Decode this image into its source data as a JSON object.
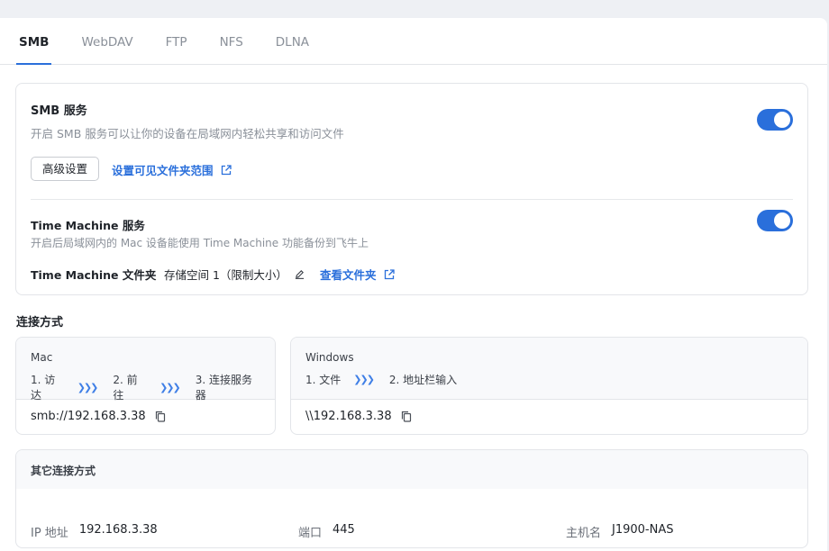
{
  "tabs": [
    {
      "label": "SMB",
      "active": true
    },
    {
      "label": "WebDAV"
    },
    {
      "label": "FTP"
    },
    {
      "label": "NFS"
    },
    {
      "label": "DLNA"
    }
  ],
  "smb": {
    "title": "SMB 服务",
    "description": "开启 SMB 服务可以让你的设备在局域网内轻松共享和访问文件",
    "enabled": true,
    "advanced_button": "高级设置",
    "visible_scope_link": "设置可见文件夹范围"
  },
  "time_machine": {
    "title": "Time Machine 服务",
    "description": "开启后局域网内的 Mac 设备能使用 Time Machine 功能备份到飞牛上",
    "enabled": true,
    "folder_label": "Time Machine 文件夹",
    "folder_value": "存储空间 1（限制大小）",
    "view_folder_link": "查看文件夹"
  },
  "connection": {
    "section_title": "连接方式",
    "mac": {
      "os": "Mac",
      "steps": [
        "1. 访达",
        "2. 前往",
        "3. 连接服务器"
      ],
      "address": "smb://192.168.3.38"
    },
    "windows": {
      "os": "Windows",
      "steps": [
        "1. 文件",
        "2. 地址栏输入"
      ],
      "address": "\\\\192.168.3.38"
    }
  },
  "other": {
    "title": "其它连接方式",
    "ip_label": "IP 地址",
    "ip_value": "192.168.3.38",
    "port_label": "端口",
    "port_value": "445",
    "host_label": "主机名",
    "host_value": "J1900-NAS"
  },
  "colors": {
    "accent": "#2a6fdb",
    "border": "#e3e5e9",
    "muted_text": "#8a9099"
  }
}
